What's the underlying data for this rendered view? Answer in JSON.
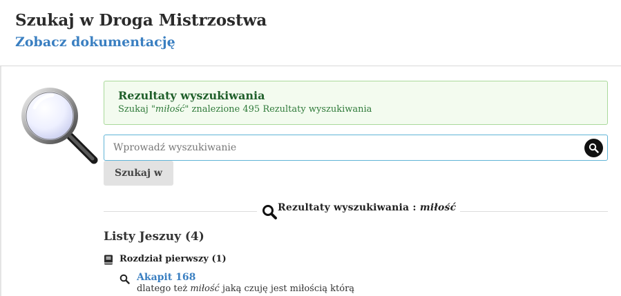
{
  "header": {
    "title": "Szukaj w Droga Mistrzostwa",
    "doc_link": "Zobacz dokumentację"
  },
  "alert": {
    "title": "Rezultaty wyszukiwania",
    "prefix": "Szukaj",
    "query_quoted": "\"miłość\"",
    "suffix": "znalezione 495 Rezultaty wyszukiwania"
  },
  "search": {
    "placeholder": "Wprowadź wyszukiwanie",
    "value": "",
    "submit_label": "Szukaj w"
  },
  "results_heading": {
    "label": "Rezultaty wyszukiwania :",
    "query": "miłość"
  },
  "groups": [
    {
      "title": "Listy Jeszuy (4)",
      "chapters": [
        {
          "title": "Rozdział pierwszy (1)",
          "results": [
            {
              "link": "Akapit 168",
              "before": "dlatego też",
              "match": "miłość",
              "after": "jaką czuję jest miłością którą"
            }
          ]
        }
      ]
    }
  ],
  "icons": {
    "hero": "magnifying-glass-icon",
    "search_button": "search-icon",
    "chapter": "book-icon",
    "result": "search-icon"
  },
  "colors": {
    "link": "#3a7fc1",
    "alert_bg": "#f3fbef",
    "alert_border": "#a9d99a",
    "alert_title": "#1f5f2a",
    "input_border": "#5fb3d6"
  }
}
